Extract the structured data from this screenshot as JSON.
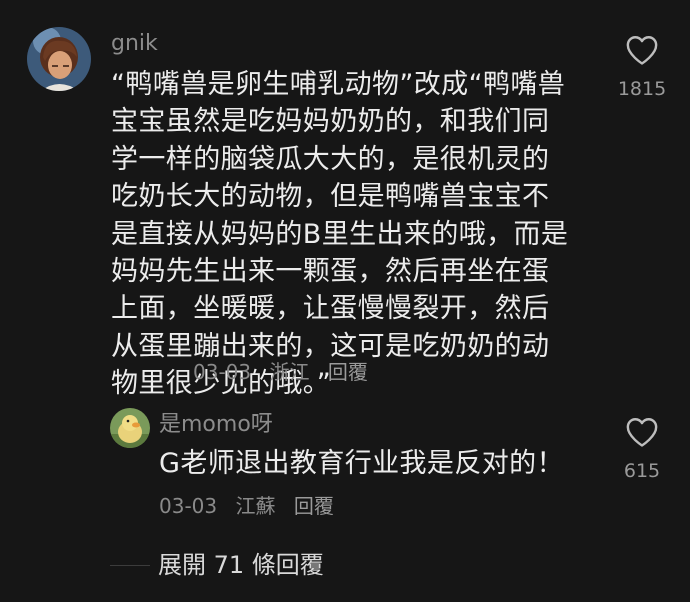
{
  "comment": {
    "username": "gnik",
    "text": "“鸭嘴兽是卵生哺乳动物”改成“鸭嘴兽宝宝虽然是吃妈妈奶奶的，和我们同学一样的脑袋瓜大大的，是很机灵的吃奶长大的动物，但是鸭嘴兽宝宝不是直接从妈妈的B里生出来的哦，而是妈妈先生出来一颗蛋，然后再坐在蛋上面，坐暖暖，让蛋慢慢裂开，然后从蛋里蹦出来的，这可是吃奶奶的动物里很少见的哦。”",
    "date": "03-03",
    "location": "浙江",
    "reply_label": "回覆",
    "like_count": "1815"
  },
  "reply": {
    "username": "是momo呀",
    "text": "G老师退出教育行业我是反对的！",
    "date": "03-03",
    "location": "江蘇",
    "reply_label": "回覆",
    "like_count": "615"
  },
  "expand_replies": {
    "label": "展開 71 條回覆"
  },
  "colors": {
    "background": "#161616",
    "text": "#ececec",
    "secondary": "#8a8a8a"
  }
}
